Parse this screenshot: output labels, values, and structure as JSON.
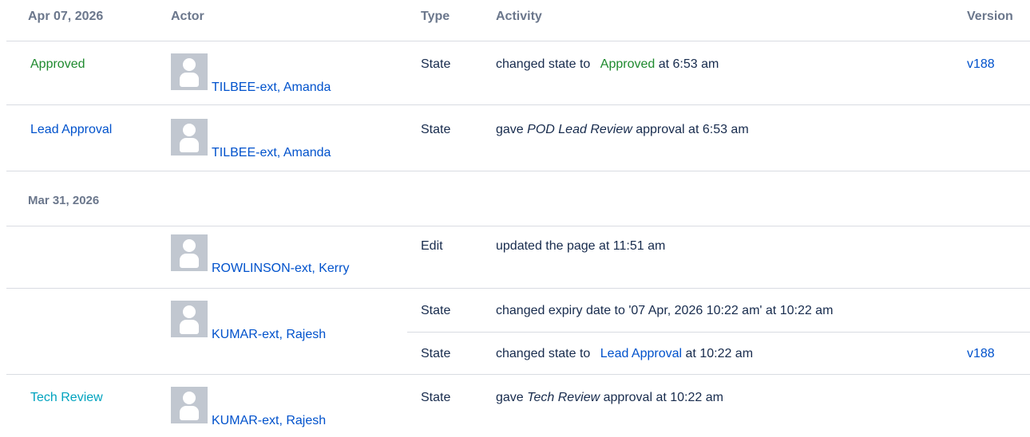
{
  "columns": {
    "date": "Apr 07, 2026",
    "actor": "Actor",
    "type": "Type",
    "activity": "Activity",
    "version": "Version"
  },
  "colors": {
    "approved": "#1e8a2e",
    "lead_approval": "#0052cc",
    "tech_review": "#00a3bf",
    "link": "#0052cc"
  },
  "rows": [
    {
      "state": "Approved",
      "actor": "TILBEE-ext, Amanda",
      "type": "State",
      "act_pre": "changed state to",
      "act_state": "Approved",
      "act_post": "at 6:53 am",
      "version": "v188"
    },
    {
      "state": "Lead Approval",
      "actor": "TILBEE-ext, Amanda",
      "type": "State",
      "act_pre": "gave",
      "act_italic": "POD Lead Review",
      "act_post": "approval at 6:53 am"
    },
    {
      "actor": "ROWLINSON-ext, Kerry",
      "type": "Edit",
      "activity": "updated the page at 11:51 am"
    },
    {
      "actor": "KUMAR-ext, Rajesh",
      "type": "State",
      "activity": "changed expiry date to '07 Apr, 2026 10:22 am' at 10:22 am"
    },
    {
      "type": "State",
      "act_pre": "changed state to",
      "act_state": "Lead Approval",
      "act_post": "at 10:22 am",
      "version": "v188"
    },
    {
      "state": "Tech Review",
      "actor": "KUMAR-ext, Rajesh",
      "type": "State",
      "act_pre": "gave",
      "act_italic": "Tech Review",
      "act_post": "approval at 10:22 am"
    }
  ],
  "date_separator": "Mar 31, 2026",
  "avatar_icon": "default-user-avatar-icon"
}
